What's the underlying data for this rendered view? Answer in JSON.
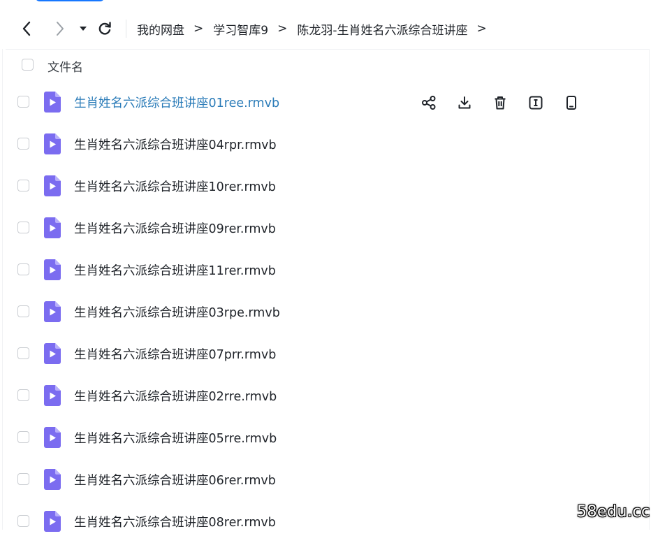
{
  "nav": {
    "back_icon": "chevron-left-icon",
    "forward_icon": "chevron-right-icon",
    "dropdown_icon": "caret-down-icon",
    "refresh_icon": "refresh-icon"
  },
  "breadcrumb": {
    "items": [
      "我的网盘",
      "学习智库9",
      "陈龙羽-生肖姓名六派综合班讲座"
    ],
    "separator": ">"
  },
  "list": {
    "header_label": "文件名",
    "files": [
      {
        "name": "生肖姓名六派综合班讲座01ree.rmvb"
      },
      {
        "name": "生肖姓名六派综合班讲座04rpr.rmvb"
      },
      {
        "name": "生肖姓名六派综合班讲座10rer.rmvb"
      },
      {
        "name": "生肖姓名六派综合班讲座09rer.rmvb"
      },
      {
        "name": "生肖姓名六派综合班讲座11rer.rmvb"
      },
      {
        "name": "生肖姓名六派综合班讲座03rpe.rmvb"
      },
      {
        "name": "生肖姓名六派综合班讲座07prr.rmvb"
      },
      {
        "name": "生肖姓名六派综合班讲座02rre.rmvb"
      },
      {
        "name": "生肖姓名六派综合班讲座05rre.rmvb"
      },
      {
        "name": "生肖姓名六派综合班讲座06rer.rmvb"
      },
      {
        "name": "生肖姓名六派综合班讲座08rer.rmvb"
      }
    ],
    "row_actions": [
      "share-icon",
      "download-icon",
      "trash-icon",
      "rename-icon",
      "phone-icon"
    ]
  },
  "watermark": "58edu.cc",
  "colors": {
    "hover_link": "#2a7bb8",
    "video_icon": "#7b6cf0",
    "accent": "#1677ff"
  }
}
